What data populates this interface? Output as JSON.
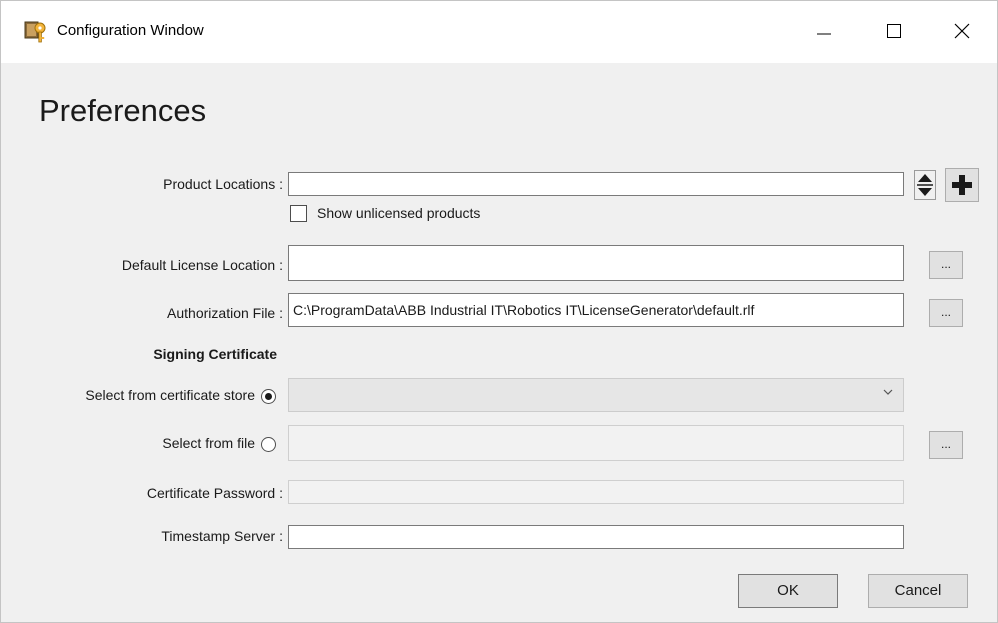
{
  "window": {
    "title": "Configuration Window",
    "app_icon": "key-license-icon"
  },
  "titlebar_controls": {
    "minimize_icon": "minimize-icon",
    "maximize_icon": "maximize-icon",
    "close_icon": "close-icon"
  },
  "page": {
    "heading": "Preferences"
  },
  "form": {
    "product_locations": {
      "label": "Product Locations :",
      "value": ""
    },
    "show_unlicensed": {
      "label": "Show unlicensed products",
      "checked": false
    },
    "default_license_location": {
      "label": "Default License Location :",
      "value": "",
      "browse_label": "..."
    },
    "authorization_file": {
      "label": "Authorization File :",
      "value": "C:\\ProgramData\\ABB Industrial IT\\Robotics IT\\LicenseGenerator\\default.rlf",
      "browse_label": "..."
    },
    "signing_certificate": {
      "heading": "Signing Certificate",
      "from_store": {
        "label": "Select from certificate store",
        "selected": true,
        "value": ""
      },
      "from_file": {
        "label": "Select from file",
        "selected": false,
        "value": "",
        "browse_label": "..."
      }
    },
    "certificate_password": {
      "label": "Certificate Password :",
      "value": ""
    },
    "timestamp_server": {
      "label": "Timestamp Server :",
      "value": ""
    }
  },
  "buttons": {
    "ok": "OK",
    "cancel": "Cancel"
  },
  "colors": {
    "window_bg": "#f0f0f0",
    "titlebar_bg": "#ffffff",
    "button_bg": "#e1e1e1",
    "field_border": "#7a7a7a"
  }
}
